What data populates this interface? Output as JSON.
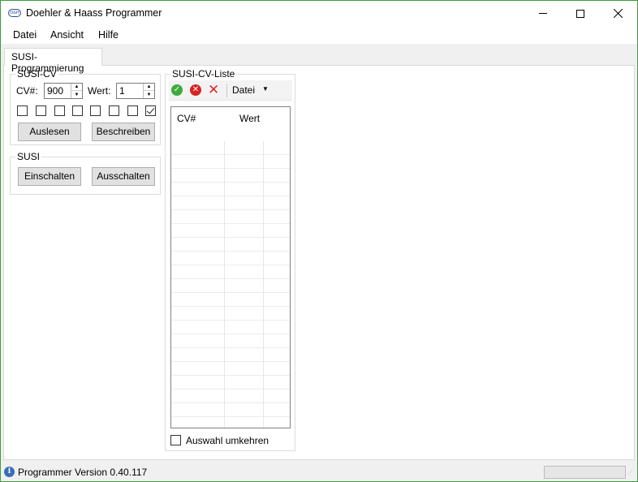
{
  "window": {
    "title": "Doehler & Haass Programmer",
    "icon_text": "D&H"
  },
  "menu": {
    "datei": "Datei",
    "ansicht": "Ansicht",
    "hilfe": "Hilfe"
  },
  "tabs": [
    {
      "label": "SUSI-Programmierung",
      "active": true
    }
  ],
  "susi_cv": {
    "title": "SUSI-CV",
    "cv_label": "CV#:",
    "cv_value": "900",
    "wert_label": "Wert:",
    "wert_value": "1",
    "bits": [
      false,
      false,
      false,
      false,
      false,
      false,
      false,
      true
    ],
    "read_button": "Auslesen",
    "write_button": "Beschreiben"
  },
  "susi": {
    "title": "SUSI",
    "on_button": "Einschalten",
    "off_button": "Ausschalten"
  },
  "cv_list": {
    "title": "SUSI-CV-Liste",
    "toolbar": {
      "datei_label": "Datei"
    },
    "columns": [
      "CV#",
      "Wert"
    ],
    "rows": [],
    "invert_label": "Auswahl umkehren",
    "invert_checked": false
  },
  "status": {
    "text": "Programmer Version 0.40.117"
  },
  "colors": {
    "ok": "#3dab3d",
    "cancel": "#d92323",
    "delete": "#e02b2b",
    "border_accent": "#3c9d3c"
  }
}
